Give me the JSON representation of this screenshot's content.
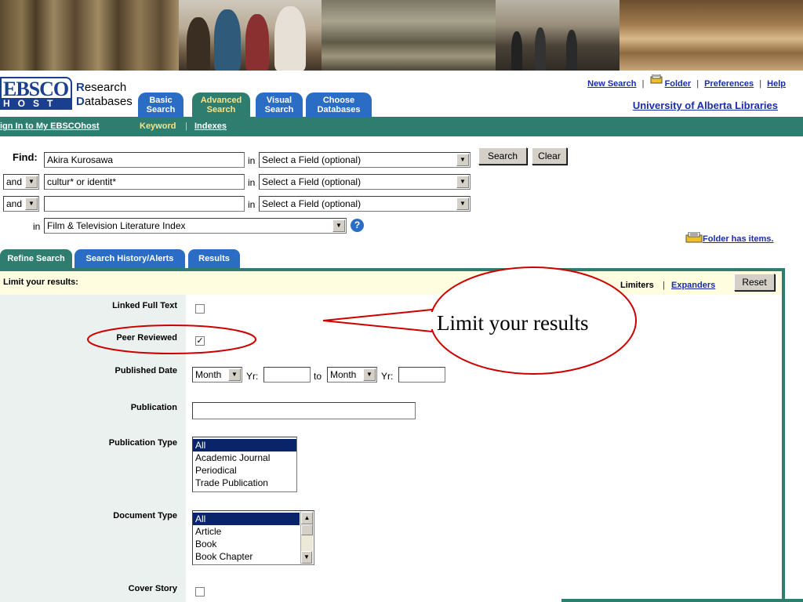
{
  "header": {
    "logo_top": "EBSCO",
    "logo_bottom": "HOST",
    "research_initial": "R",
    "research_rest": "esearch",
    "databases_initial": "D",
    "databases_rest": "atabases",
    "tabs": [
      {
        "line1": "Basic",
        "line2": "Search"
      },
      {
        "line1": "Advanced",
        "line2": "Search"
      },
      {
        "line1": "Visual",
        "line2": "Search"
      },
      {
        "line1": "Choose",
        "line2": "Databases"
      }
    ],
    "links": {
      "new_search": "New Search",
      "folder": "Folder",
      "preferences": "Preferences",
      "help": "Help"
    },
    "institution": "University of Alberta Libraries"
  },
  "greenbar": {
    "sign_in": "ign In to My EBSCOhost",
    "keyword": "Keyword",
    "indexes": "Indexes"
  },
  "search": {
    "find_label": "Find:",
    "in_label": "in",
    "rows": [
      {
        "operator": "",
        "term": "Akira Kurosawa",
        "field": "Select a Field (optional)"
      },
      {
        "operator": "and",
        "term": "cultur* or identit*",
        "field": "Select a Field (optional)"
      },
      {
        "operator": "and",
        "term": "",
        "field": "Select a Field (optional)"
      }
    ],
    "search_button": "Search",
    "clear_button": "Clear",
    "database": "Film & Television Literature Index",
    "help_glyph": "?"
  },
  "folder_status": "Folder has items.",
  "tabs": {
    "refine": "Refine Search",
    "history": "Search History/Alerts",
    "results": "Results"
  },
  "limits": {
    "heading": "Limit your results:",
    "limiters": "Limiters",
    "expanders": "Expanders",
    "reset": "Reset",
    "linked_full_text": "Linked Full Text",
    "peer_reviewed": "Peer Reviewed",
    "published_date": "Published Date",
    "month_1": "Month",
    "yr_1": "Yr:",
    "to": "to",
    "month_2": "Month",
    "yr_2": "Yr:",
    "publication": "Publication",
    "publication_type": "Publication Type",
    "publication_type_options": [
      "All",
      "Academic Journal",
      "Periodical",
      "Trade Publication"
    ],
    "document_type": "Document Type",
    "document_type_options": [
      "All",
      "Article",
      "Book",
      "Book Chapter"
    ],
    "cover_story": "Cover Story",
    "peer_reviewed_checked": true,
    "linked_full_text_checked": false,
    "cover_story_checked": false
  },
  "annotation": {
    "callout": "Limit your results",
    "color": "#cc0000"
  },
  "colors": {
    "green": "#2f7d6f",
    "blue_tab": "#2b6cc4",
    "link": "#1a2ca8",
    "selected": "#0a246a"
  }
}
